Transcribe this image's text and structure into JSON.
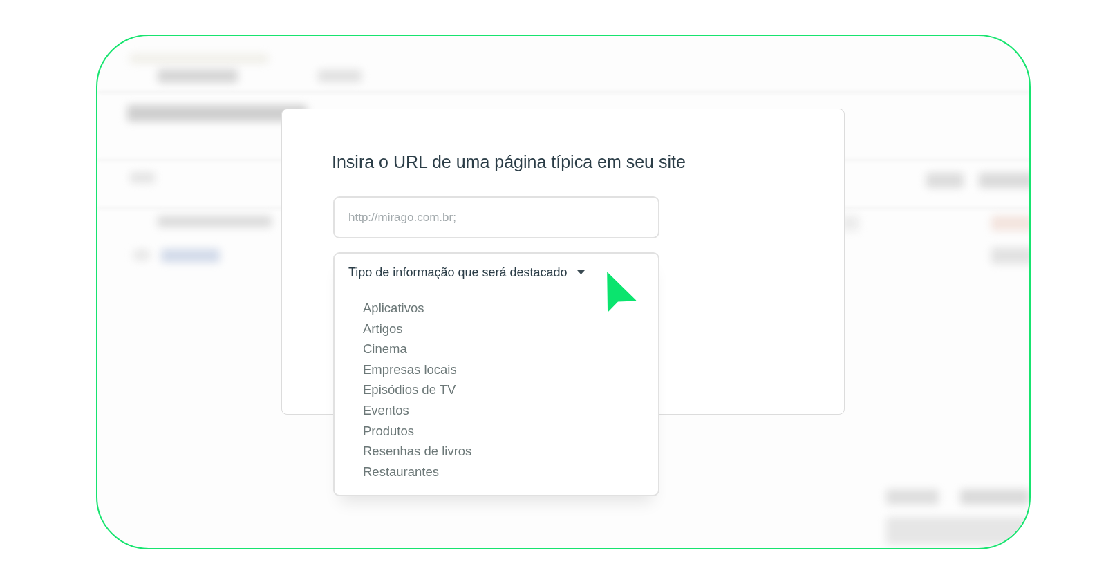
{
  "dialog": {
    "title": "Insira o URL de uma página típica em seu site",
    "url_field": {
      "placeholder": "http://mirago.com.br;"
    },
    "type_dropdown": {
      "label": "Tipo de informação que será destacado",
      "expanded": true,
      "options": [
        {
          "label": "Aplicativos",
          "selected": false
        },
        {
          "label": "Artigos",
          "selected": false
        },
        {
          "label": "Cinema",
          "selected": false
        },
        {
          "label": "Empresas locais",
          "selected": false
        },
        {
          "label": "Episódios de TV",
          "selected": false
        },
        {
          "label": "Eventos",
          "selected": false
        },
        {
          "label": "Produtos",
          "selected": false
        },
        {
          "label": "Resenhas de livros",
          "selected": false
        },
        {
          "label": "Restaurantes",
          "selected": false
        }
      ]
    }
  }
}
